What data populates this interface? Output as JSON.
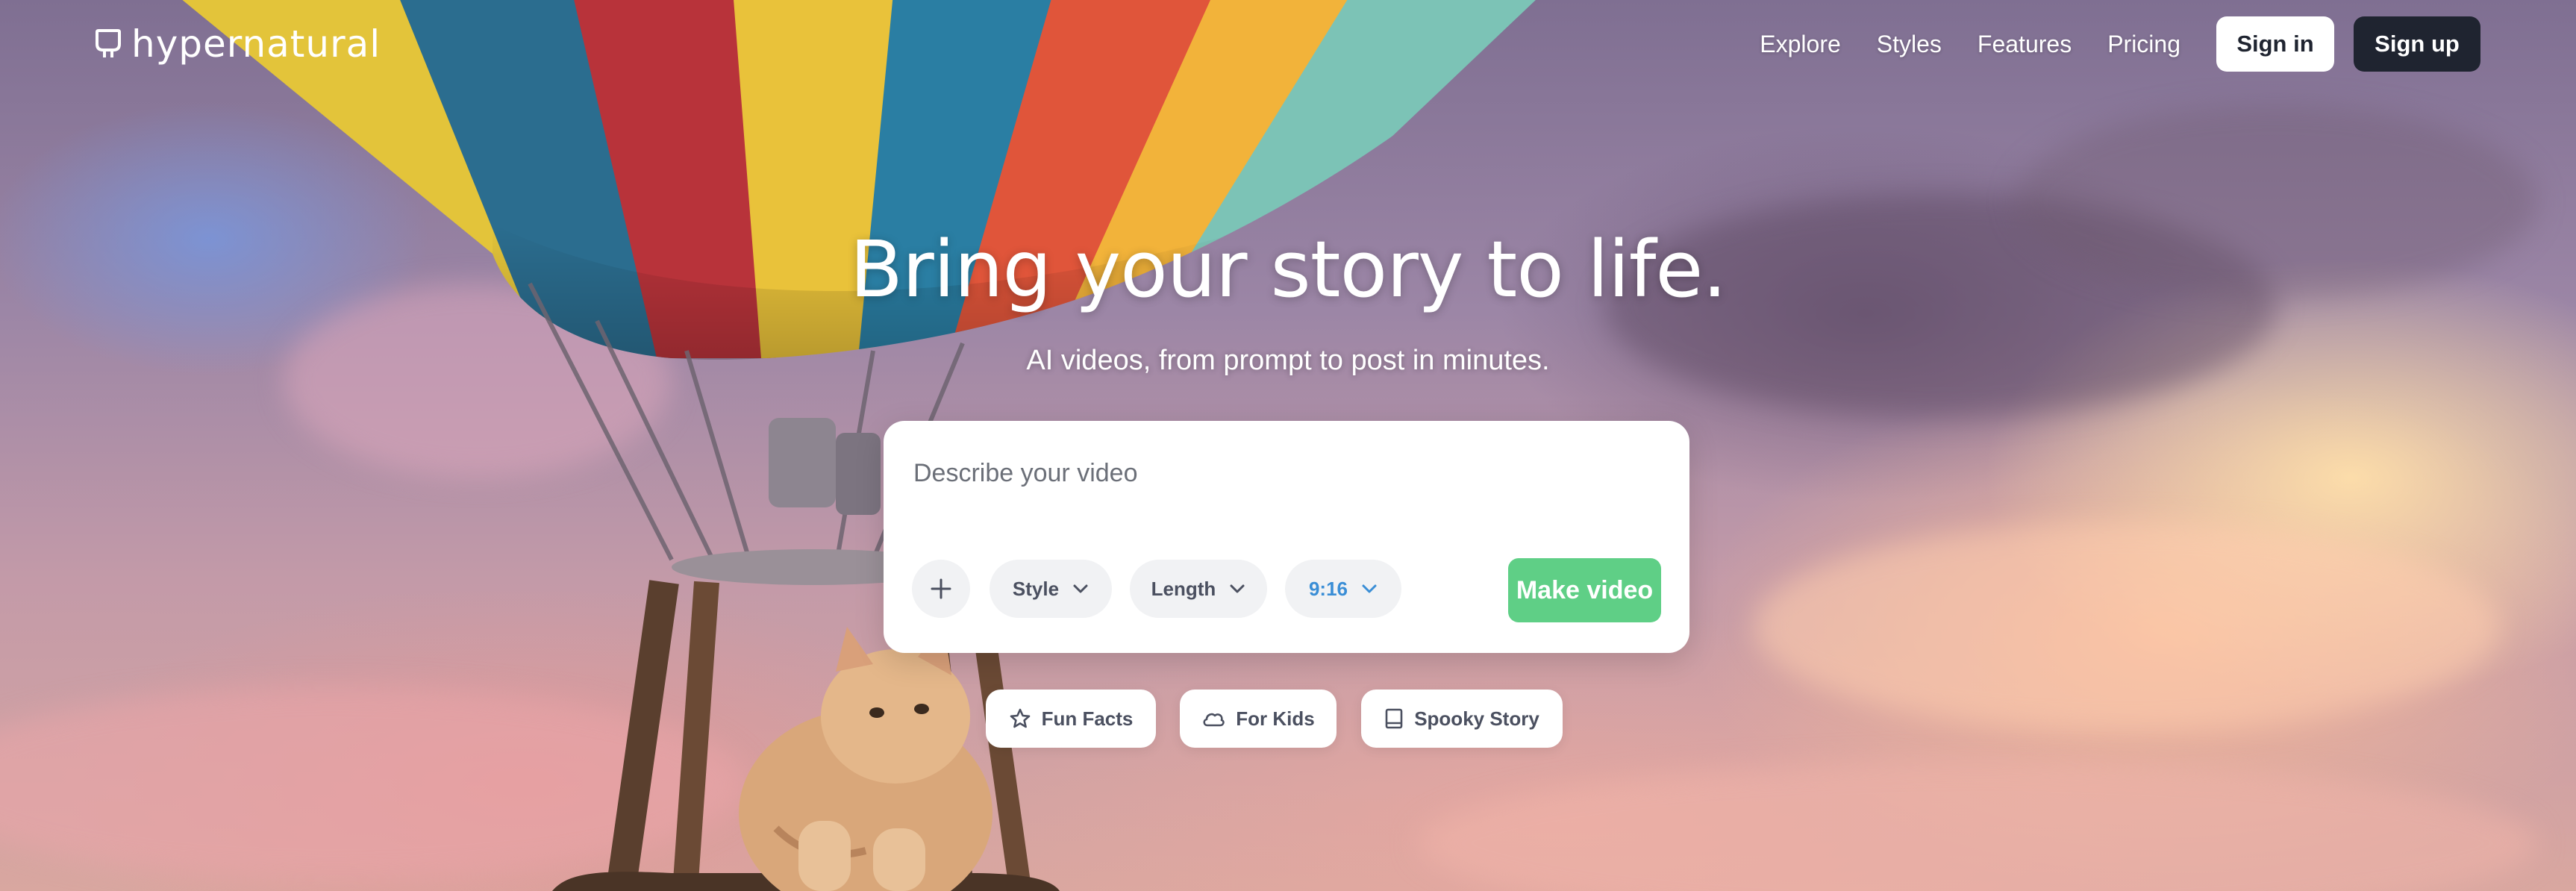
{
  "brand": {
    "name": "hypernatural"
  },
  "nav": {
    "links": [
      "Explore",
      "Styles",
      "Features",
      "Pricing"
    ],
    "sign_in": "Sign in",
    "sign_up": "Sign up"
  },
  "hero": {
    "title": "Bring your story to life.",
    "subtitle": "AI videos, from prompt to post in minutes."
  },
  "prompt": {
    "placeholder": "Describe your video",
    "value": "",
    "add_icon": "plus-icon",
    "style_label": "Style",
    "length_label": "Length",
    "ratio_label": "9:16",
    "make_label": "Make video"
  },
  "suggestions": [
    {
      "label": "Fun Facts",
      "icon": "star-icon"
    },
    {
      "label": "For Kids",
      "icon": "cloud-icon"
    },
    {
      "label": "Spooky Story",
      "icon": "book-icon"
    }
  ],
  "colors": {
    "accent_green": "#5fcf86",
    "dark_button": "#1f2430",
    "ratio_blue": "#3a8ed6"
  }
}
